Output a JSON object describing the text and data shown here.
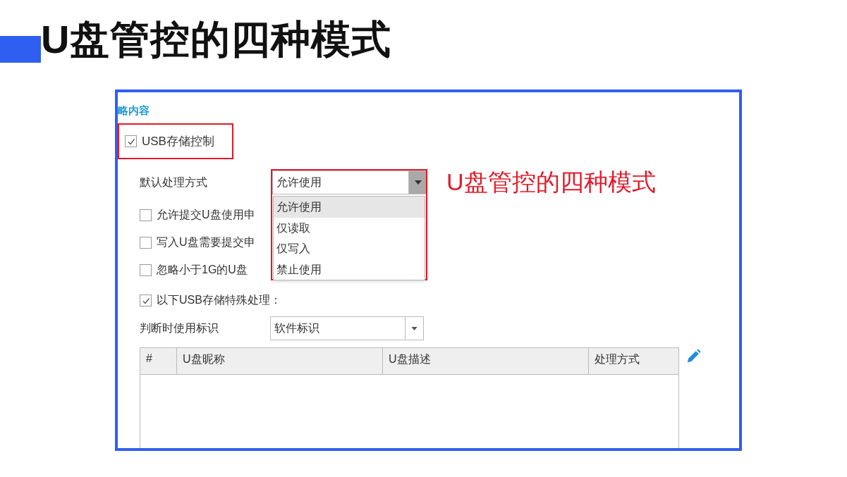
{
  "slide": {
    "title": "U盘管控的四种模式"
  },
  "screenshot": {
    "section_title": "略内容",
    "usb_control": {
      "label": "USB存储控制",
      "checked": true
    },
    "default_action": {
      "label": "默认处理方式",
      "value": "允许使用",
      "expanded": true,
      "options": [
        {
          "label": "允许使用",
          "selected": true
        },
        {
          "label": "仅读取",
          "selected": false
        },
        {
          "label": "仅写入",
          "selected": false
        },
        {
          "label": "禁止使用",
          "selected": false
        }
      ]
    },
    "annotation": "U盘管控的四种模式",
    "options": [
      {
        "label": "允许提交U盘使用申",
        "checked": false
      },
      {
        "label": "写入U盘需要提交申",
        "checked": false
      },
      {
        "label": "忽略小于1G的U盘",
        "checked": false
      }
    ],
    "special": {
      "label": "以下USB存储特殊处理：",
      "checked": true
    },
    "identifier": {
      "label": "判断时使用标识",
      "value": "软件标识"
    },
    "table": {
      "columns": [
        "#",
        "U盘昵称",
        "U盘描述",
        "处理方式"
      ]
    }
  }
}
